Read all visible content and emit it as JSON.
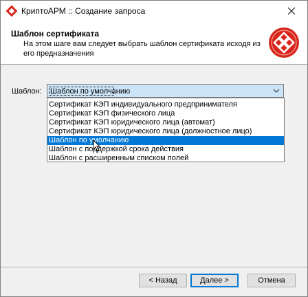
{
  "window": {
    "title": "КриптоАРМ :: Создание запроса"
  },
  "header": {
    "title": "Шаблон сертификата",
    "description": "На этом шаге вам следует выбрать шаблон сертификата исходя из его предназначения"
  },
  "form": {
    "template_label": "Шаблон:",
    "template_value": "Шаблон по умолчанию",
    "options": [
      "Сертификат КЭП индивидуального предпринимателя",
      "Сертификат КЭП физического лица",
      "Сертификат КЭП юридического лица (автомат)",
      "Сертификат КЭП юридического лица (должностное лицо)",
      "Шаблон по умолчанию",
      "Шаблон с поддержкой срока действия",
      "Шаблон с расширенным списком полей"
    ],
    "selected_index": 4
  },
  "buttons": {
    "back": "< Назад",
    "next": "Далее >",
    "cancel": "Отмена"
  },
  "colors": {
    "selection": "#0078d7",
    "combo_focus": "#cce4f7",
    "logo_red": "#d9261c"
  },
  "icons": {
    "app": "cryptoarm-app-icon",
    "close": "close-icon",
    "logo": "cryptoarm-logo-icon",
    "dropdown": "chevron-down-icon",
    "cursor": "mouse-cursor-icon"
  }
}
